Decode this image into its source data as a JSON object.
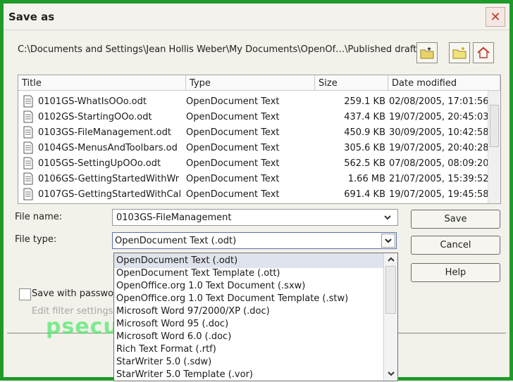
{
  "window": {
    "title": "Save as",
    "close_glyph": "✕"
  },
  "path": "C:\\Documents and Settings\\Jean Hollis Weber\\My Documents\\OpenOf…\\Published drafts",
  "toolbar": {
    "icons": [
      "folder-up-icon",
      "new-folder-icon",
      "home-icon"
    ]
  },
  "columns": {
    "title": "Title",
    "type": "Type",
    "size": "Size",
    "date": "Date modified"
  },
  "files": [
    {
      "name": "0101GS-WhatIsOOo.odt",
      "type": "OpenDocument Text",
      "size": "259.1 KB",
      "date": "02/08/2005, 17:01:56"
    },
    {
      "name": "0102GS-StartingOOo.odt",
      "type": "OpenDocument Text",
      "size": "437.4 KB",
      "date": "19/07/2005, 20:45:03"
    },
    {
      "name": "0103GS-FileManagement.odt",
      "type": "OpenDocument Text",
      "size": "450.9 KB",
      "date": "30/09/2005, 10:42:58"
    },
    {
      "name": "0104GS-MenusAndToolbars.od",
      "type": "OpenDocument Text",
      "size": "305.6 KB",
      "date": "19/07/2005, 20:40:28"
    },
    {
      "name": "0105GS-SettingUpOOo.odt",
      "type": "OpenDocument Text",
      "size": "562.5 KB",
      "date": "07/08/2005, 08:09:20"
    },
    {
      "name": "0106GS-GettingStartedWithWr",
      "type": "OpenDocument Text",
      "size": "1.66 MB",
      "date": "21/07/2005, 15:39:52"
    },
    {
      "name": "0107GS-GettingStartedWithCal",
      "type": "OpenDocument Text",
      "size": "691.4 KB",
      "date": "19/07/2005, 19:45:58"
    }
  ],
  "form": {
    "filename_label": "File name:",
    "filename_value": "0103GS-FileManagement",
    "filetype_label": "File type:",
    "filetype_value": "OpenDocument Text (.odt)",
    "save_password_label": "Save with passwo",
    "edit_filter_label": "Edit filter settings"
  },
  "buttons": {
    "save": "Save",
    "cancel": "Cancel",
    "help": "Help"
  },
  "filetype_options": [
    "OpenDocument Text (.odt)",
    "OpenDocument Text Template (.ott)",
    "OpenOffice.org 1.0 Text Document (.sxw)",
    "OpenOffice.org 1.0 Text Document Template (.stw)",
    "Microsoft Word 97/2000/XP (.doc)",
    "Microsoft Word 95 (.doc)",
    "Microsoft Word 6.0 (.doc)",
    "Rich Text Format (.rtf)",
    "StarWriter 5.0 (.sdw)",
    "StarWriter 5.0 Template (.vor)"
  ],
  "watermark": "psecuador.org",
  "colors": {
    "frame": "#1f9a2a",
    "selected_option": "#dfe3ec"
  }
}
